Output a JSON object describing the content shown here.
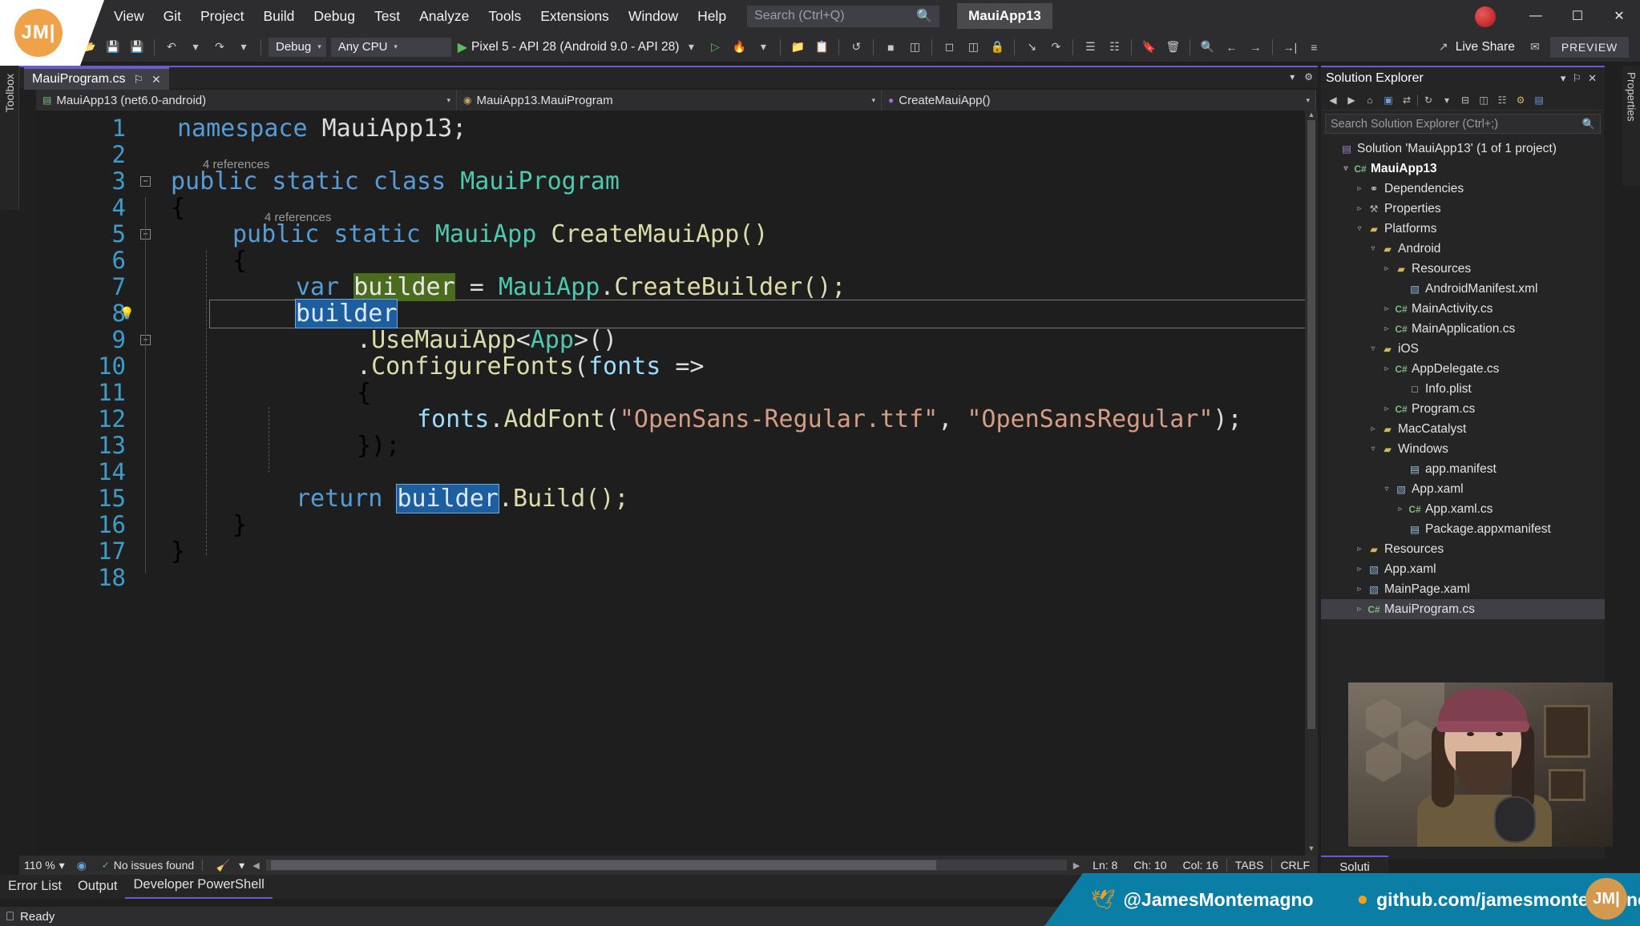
{
  "window": {
    "menu": [
      "View",
      "Git",
      "Project",
      "Build",
      "Debug",
      "Test",
      "Analyze",
      "Tools",
      "Extensions",
      "Window",
      "Help"
    ],
    "search_placeholder": "Search (Ctrl+Q)",
    "project_chip": "MauiApp13",
    "minimize": "—",
    "maximize": "☐",
    "close": "✕"
  },
  "toolbar": {
    "config": "Debug",
    "platform": "Any CPU",
    "run_target": "Pixel 5 - API 28 (Android 9.0 - API 28)",
    "live_share": "Live Share",
    "preview": "PREVIEW"
  },
  "toolbox": {
    "label": "Toolbox"
  },
  "properties_strip": {
    "label": "Properties"
  },
  "tab": {
    "name": "MauiProgram.cs",
    "pin": "⚐",
    "close": "✕"
  },
  "navbar": {
    "project": "MauiApp13 (net6.0-android)",
    "type": "MauiApp13.MauiProgram",
    "member": "CreateMauiApp()",
    "caret": "▾"
  },
  "editor": {
    "lines": [
      1,
      2,
      3,
      4,
      5,
      6,
      7,
      8,
      9,
      10,
      11,
      12,
      13,
      14,
      15,
      16,
      17,
      18
    ],
    "reference_hint_class": "4 references",
    "reference_hint_method": "4 references",
    "code": {
      "l1_kw": "namespace",
      "l1_name": "MauiApp13;",
      "l3_kw": "public static class",
      "l3_type": "MauiProgram",
      "l4": "{",
      "l5_kw": "public static",
      "l5_type": "MauiApp",
      "l5_meth": "CreateMauiApp()",
      "l6": "{",
      "l7_kw": "var",
      "l7_hl": "builder",
      "l7_eq": "=",
      "l7_type": "MauiApp",
      "l7_dot": ".",
      "l7_meth": "CreateBuilder();",
      "l8_sel": "builder",
      "l9_dot": ".",
      "l9_meth": "UseMauiApp",
      "l9_lt": "<",
      "l9_type": "App",
      "l9_gt": ">()",
      "l10_dot": ".",
      "l10_meth": "ConfigureFonts",
      "l10_open": "(",
      "l10_param": "fonts",
      "l10_arrow": "=>",
      "l11": "{",
      "l12_obj": "fonts",
      "l12_dot": ".",
      "l12_meth": "AddFont",
      "l12_open": "(",
      "l12_str1": "\"OpenSans-Regular.ttf\"",
      "l12_comma": ", ",
      "l12_str2": "\"OpenSansRegular\"",
      "l12_close": ");",
      "l13": "});",
      "l15_kw": "return",
      "l15_hl": "builder",
      "l15_dot": ".",
      "l15_meth": "Build();",
      "l16": "}",
      "l17": "}"
    }
  },
  "statusbar": {
    "zoom": "110 %",
    "issues": "No issues found",
    "line": "Ln: 8",
    "char": "Ch: 10",
    "col": "Col: 16",
    "tabs": "TABS",
    "eol": "CRLF",
    "caret": "▾"
  },
  "panel_tabs": [
    "Error List",
    "Output",
    "Developer PowerShell"
  ],
  "bottom_status": {
    "ready": "Ready"
  },
  "solution_explorer": {
    "title": "Solution Explorer",
    "search_placeholder": "Search Solution Explorer (Ctrl+;)",
    "dock_tab": "Soluti",
    "pin": "⚐",
    "close": "✕",
    "caret": "▾",
    "tree": [
      {
        "label": "Solution 'MauiApp13' (1 of 1 project)",
        "indent": 0,
        "arrow": "none",
        "icon": "▤",
        "icon_class": "i-sln",
        "bold": false,
        "selected": false
      },
      {
        "label": "MauiApp13",
        "indent": 1,
        "arrow": "▿",
        "icon": "C#",
        "icon_class": "i-cs",
        "bold": true,
        "selected": false
      },
      {
        "label": "Dependencies",
        "indent": 2,
        "arrow": "▹",
        "icon": "⚭",
        "icon_class": "i-dep",
        "bold": false,
        "selected": false
      },
      {
        "label": "Properties",
        "indent": 2,
        "arrow": "▹",
        "icon": "⚒",
        "icon_class": "i-props",
        "bold": false,
        "selected": false
      },
      {
        "label": "Platforms",
        "indent": 2,
        "arrow": "▿",
        "icon": "▰",
        "icon_class": "i-folder",
        "bold": false,
        "selected": false
      },
      {
        "label": "Android",
        "indent": 3,
        "arrow": "▿",
        "icon": "▰",
        "icon_class": "i-folder",
        "bold": false,
        "selected": false
      },
      {
        "label": "Resources",
        "indent": 4,
        "arrow": "▹",
        "icon": "▰",
        "icon_class": "i-folder",
        "bold": false,
        "selected": false
      },
      {
        "label": "AndroidManifest.xml",
        "indent": 5,
        "arrow": "none",
        "icon": "▧",
        "icon_class": "i-xaml",
        "bold": false,
        "selected": false
      },
      {
        "label": "MainActivity.cs",
        "indent": 4,
        "arrow": "▹",
        "icon": "C#",
        "icon_class": "i-cs",
        "bold": false,
        "selected": false
      },
      {
        "label": "MainApplication.cs",
        "indent": 4,
        "arrow": "▹",
        "icon": "C#",
        "icon_class": "i-cs",
        "bold": false,
        "selected": false
      },
      {
        "label": "iOS",
        "indent": 3,
        "arrow": "▿",
        "icon": "▰",
        "icon_class": "i-folder",
        "bold": false,
        "selected": false
      },
      {
        "label": "AppDelegate.cs",
        "indent": 4,
        "arrow": "▹",
        "icon": "C#",
        "icon_class": "i-cs",
        "bold": false,
        "selected": false
      },
      {
        "label": "Info.plist",
        "indent": 5,
        "arrow": "none",
        "icon": "□",
        "icon_class": "i-file",
        "bold": false,
        "selected": false
      },
      {
        "label": "Program.cs",
        "indent": 4,
        "arrow": "▹",
        "icon": "C#",
        "icon_class": "i-cs",
        "bold": false,
        "selected": false
      },
      {
        "label": "MacCatalyst",
        "indent": 3,
        "arrow": "▹",
        "icon": "▰",
        "icon_class": "i-folder",
        "bold": false,
        "selected": false
      },
      {
        "label": "Windows",
        "indent": 3,
        "arrow": "▿",
        "icon": "▰",
        "icon_class": "i-folder",
        "bold": false,
        "selected": false
      },
      {
        "label": "app.manifest",
        "indent": 5,
        "arrow": "none",
        "icon": "▤",
        "icon_class": "i-pkg",
        "bold": false,
        "selected": false
      },
      {
        "label": "App.xaml",
        "indent": 4,
        "arrow": "▿",
        "icon": "▧",
        "icon_class": "i-xaml",
        "bold": false,
        "selected": false
      },
      {
        "label": "App.xaml.cs",
        "indent": 5,
        "arrow": "▹",
        "icon": "C#",
        "icon_class": "i-cs",
        "bold": false,
        "selected": false
      },
      {
        "label": "Package.appxmanifest",
        "indent": 5,
        "arrow": "none",
        "icon": "▤",
        "icon_class": "i-pkg",
        "bold": false,
        "selected": false
      },
      {
        "label": "Resources",
        "indent": 2,
        "arrow": "▹",
        "icon": "▰",
        "icon_class": "i-folder",
        "bold": false,
        "selected": false
      },
      {
        "label": "App.xaml",
        "indent": 2,
        "arrow": "▹",
        "icon": "▧",
        "icon_class": "i-xaml",
        "bold": false,
        "selected": false
      },
      {
        "label": "MainPage.xaml",
        "indent": 2,
        "arrow": "▹",
        "icon": "▧",
        "icon_class": "i-xaml",
        "bold": false,
        "selected": false
      },
      {
        "label": "MauiProgram.cs",
        "indent": 2,
        "arrow": "▹",
        "icon": "C#",
        "icon_class": "i-cs",
        "bold": false,
        "selected": true
      }
    ]
  },
  "branding": {
    "twitter_handle": "@JamesMontemagno",
    "github_url": "github.com/jamesmontemagno",
    "twitter_glyph": "🕊",
    "github_glyph": "●",
    "logo": "JM|"
  },
  "colors": {
    "accent_purple": "#6a5acd",
    "brand_teal": "#0a7ea4",
    "logo_orange": "#f0a24a",
    "keyword": "#569cd6",
    "type": "#4ec9b0",
    "method": "#dcdcaa",
    "string": "#d69d85",
    "highlight_green": "#4b6b1f",
    "selection_blue": "#1d5f9e"
  }
}
